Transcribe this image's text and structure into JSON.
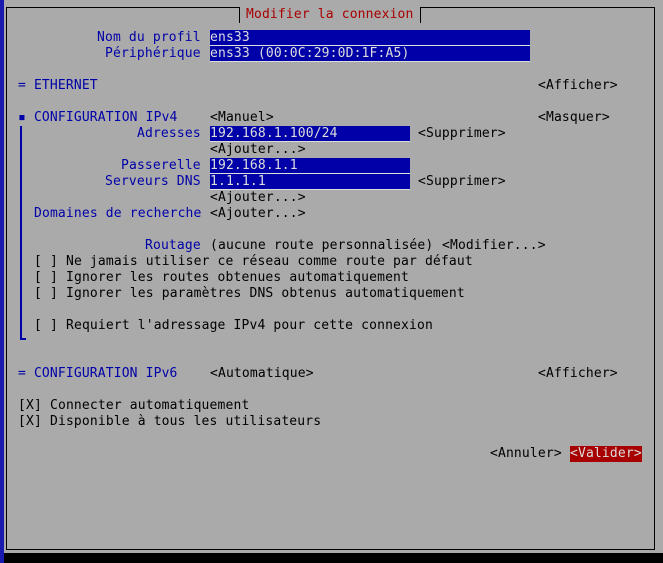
{
  "title": "Modifier la connexion",
  "profile": {
    "label": "Nom du profil",
    "value": "ens33"
  },
  "device": {
    "label": "Périphérique",
    "value": "ens33 (00:0C:29:0D:1F:A5)"
  },
  "ethernet": {
    "label": "= ETHERNET",
    "toggle": "<Afficher>"
  },
  "ipv4": {
    "label": "▪ CONFIGURATION IPv4",
    "mode": "<Manuel>",
    "toggle": "<Masquer>",
    "addresses_label": "Adresses",
    "address": "192.168.1.100/24",
    "remove": "<Supprimer>",
    "add": "<Ajouter...>",
    "gateway_label": "Passerelle",
    "gateway": "192.168.1.1",
    "dns_label": "Serveurs DNS",
    "dns": "1.1.1.1",
    "dns_remove": "<Supprimer>",
    "dns_add": "<Ajouter...>",
    "search_label": "Domaines de recherche",
    "search_add": "<Ajouter...>",
    "routing_label": "Routage",
    "routing_value": "(aucune route personnalisée)",
    "routing_edit": "<Modifier...>",
    "checks": [
      {
        "box": "[ ]",
        "label": "Ne jamais utiliser ce réseau comme route par défaut"
      },
      {
        "box": "[ ]",
        "label": "Ignorer les routes obtenues automatiquement"
      },
      {
        "box": "[ ]",
        "label": "Ignorer les paramètres DNS obtenus automatiquement"
      }
    ],
    "require": {
      "box": "[ ]",
      "label": "Requiert l'adressage IPv4 pour cette connexion"
    }
  },
  "ipv6": {
    "label": "= CONFIGURATION IPv6",
    "mode": "<Automatique>",
    "toggle": "<Afficher>"
  },
  "autoconnect": {
    "box": "[X]",
    "label": "Connecter automatiquement"
  },
  "allusers": {
    "box": "[X]",
    "label": "Disponible à tous les utilisateurs"
  },
  "buttons": {
    "cancel": "<Annuler>",
    "ok": "<Valider>"
  }
}
